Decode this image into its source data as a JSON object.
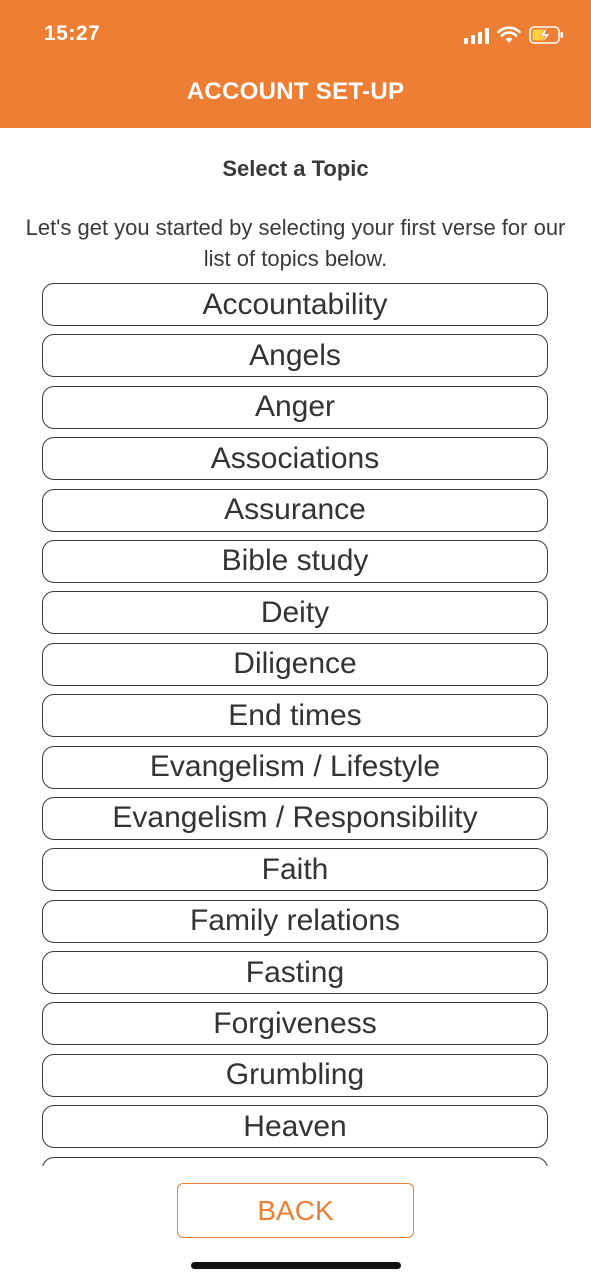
{
  "status_bar": {
    "time": "15:27",
    "icons": [
      "cellular-signal-icon",
      "wifi-icon",
      "battery-charging-icon"
    ]
  },
  "header": {
    "title": "ACCOUNT SET-UP",
    "background_color": "#EE7E33"
  },
  "main": {
    "subtitle": "Select a Topic",
    "intro": "Let's get you started by selecting your first verse for our list of topics below.",
    "topics": [
      "Accountability",
      "Angels",
      "Anger",
      "Associations",
      "Assurance",
      "Bible study",
      "Deity",
      "Diligence",
      "End times",
      "Evangelism / Lifestyle",
      "Evangelism / Responsibility",
      "Faith",
      "Family relations",
      "Fasting",
      "Forgiveness",
      "Grumbling",
      "Heaven",
      ""
    ]
  },
  "footer": {
    "back_label": "BACK",
    "accent_color": "#EE7E33"
  }
}
